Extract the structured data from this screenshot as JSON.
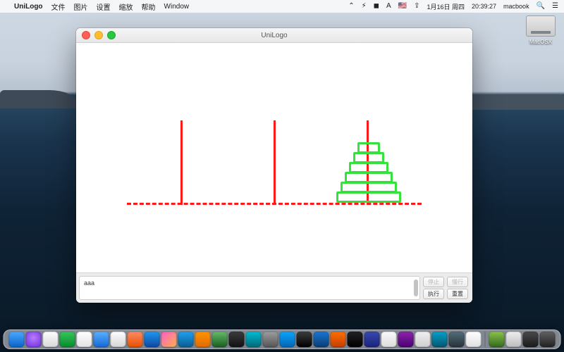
{
  "menu": {
    "app": "UniLogo",
    "items": [
      "文件",
      "图片",
      "设置",
      "缩放",
      "帮助",
      "Window"
    ],
    "status": {
      "wifi": "⌃",
      "batt": "⚡︎",
      "vol": "◼︎",
      "ime": "A",
      "flag": "🇺🇸",
      "lock": "⇪",
      "date": "1月16日 周四",
      "time": "20:39:27",
      "user": "macbook",
      "spot": "🔍",
      "cc": "☰"
    }
  },
  "disk": {
    "label": "MacOSX"
  },
  "window": {
    "title": "UniLogo",
    "cmd_text": "aaa",
    "btn_stop": "停止",
    "btn_step": "慢行",
    "btn_run": "执行",
    "btn_reset": "重置"
  },
  "hanoi": {
    "pegs": 3,
    "discs_on_peg3": 6,
    "colors": {
      "peg": "#ff1a1a",
      "base": "#ff1a1a",
      "disc": "#35e23c"
    }
  },
  "dock_colors": [
    "linear-gradient(#4aa8ff,#0a63c9)",
    "radial-gradient(circle at 50% 40%,#b97cff,#6a2bd9)",
    "linear-gradient(#fdfdfd,#d9d9d9)",
    "linear-gradient(#34c759,#0a8a2e)",
    "linear-gradient(#ffffff,#e3e3e3)",
    "linear-gradient(#5ab0ff,#1469d4)",
    "linear-gradient(#fefefe,#d6d6d6)",
    "linear-gradient(#ff8a65,#e65100)",
    "linear-gradient(#2196f3,#0d47a1)",
    "linear-gradient(135deg,#ff5cc8,#ffb14e)",
    "linear-gradient(#1da1f2,#0b5d91)",
    "linear-gradient(#ff9500,#e06a00)",
    "linear-gradient(#66bb6a,#1b5e20)",
    "linear-gradient(#3b3b3b,#111)",
    "linear-gradient(#00bcd4,#006978)",
    "linear-gradient(#9e9e9e,#555)",
    "linear-gradient(#0aa5ff,#0465b2)",
    "linear-gradient(#3c3c3c,#000)",
    "linear-gradient(#1976d2,#0a3d73)",
    "linear-gradient(#ff6f00,#c43e00)",
    "linear-gradient(#212121,#000)",
    "linear-gradient(#3949ab,#1a237e)",
    "linear-gradient(#fafafa,#dcdcdc)",
    "linear-gradient(#8e24aa,#4a0072)",
    "linear-gradient(#efefef,#cfcfcf)",
    "linear-gradient(#06a0c9,#035670)",
    "linear-gradient(#546e7a,#263238)",
    "linear-gradient(#fefefe,#e0e0e0)",
    "linear-gradient(#8bc34a,#33691e)",
    "linear-gradient(#eeeeee,#bdbdbd)",
    "linear-gradient(#4a4a4a,#1a1a1a)",
    "linear-gradient(#616161,#212121)"
  ]
}
